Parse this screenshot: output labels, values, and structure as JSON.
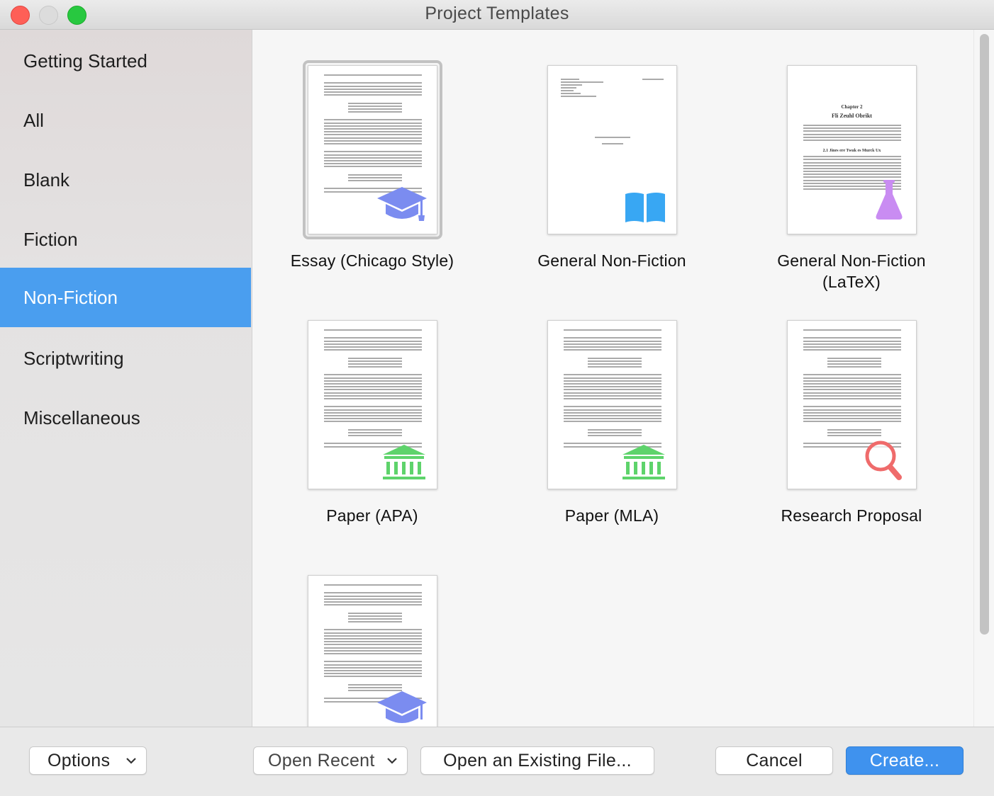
{
  "window": {
    "title": "Project Templates"
  },
  "sidebar": {
    "items": [
      {
        "label": "Getting Started",
        "selected": false
      },
      {
        "label": "All",
        "selected": false
      },
      {
        "label": "Blank",
        "selected": false
      },
      {
        "label": "Fiction",
        "selected": false
      },
      {
        "label": "Non-Fiction",
        "selected": true
      },
      {
        "label": "Scriptwriting",
        "selected": false
      },
      {
        "label": "Miscellaneous",
        "selected": false
      }
    ]
  },
  "templates": [
    {
      "label": "Essay (Chicago Style)",
      "icon": "graduation-cap-icon",
      "selected": true
    },
    {
      "label": "General Non-Fiction",
      "icon": "open-book-icon",
      "selected": false
    },
    {
      "label": "General Non-Fiction\n(LaTeX)",
      "label_line1": "General Non-Fiction",
      "label_line2": "(LaTeX)",
      "icon": "flask-icon",
      "selected": false
    },
    {
      "label": "Paper (APA)",
      "icon": "building-columns-icon",
      "selected": false
    },
    {
      "label": "Paper (MLA)",
      "icon": "building-columns-icon",
      "selected": false
    },
    {
      "label": "Research Proposal",
      "icon": "magnifying-glass-icon",
      "selected": false
    },
    {
      "label": "",
      "icon": "graduation-cap-icon",
      "selected": false
    }
  ],
  "thumb_text": {
    "latex_chapter": "Chapter 2",
    "latex_title": "Fli Zeuhl Obrikt",
    "latex_section": "2.1 Jines ere Twuk es Murck Ux"
  },
  "footer": {
    "options_label": "Options",
    "open_recent_label": "Open Recent",
    "open_existing_label": "Open an Existing File...",
    "cancel_label": "Cancel",
    "create_label": "Create..."
  },
  "colors": {
    "selection_blue": "#4a9eef",
    "primary_button": "#3f92ee",
    "icon_purple": "#7b8cf0",
    "icon_blue": "#38a7f3",
    "icon_lilac": "#c98cf2",
    "icon_green": "#5ed36b",
    "icon_red": "#ef6b6b"
  }
}
